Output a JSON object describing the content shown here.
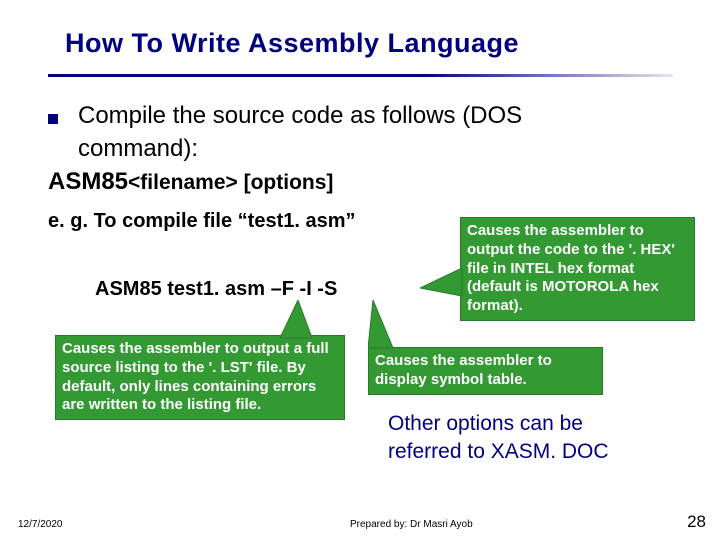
{
  "title": "How To Write Assembly Language",
  "bullet": {
    "line1": "Compile the source code as follows (DOS",
    "line2": "command):"
  },
  "asm85": {
    "cmd": "ASM85",
    "filename": "<filename>",
    "options": " [options]"
  },
  "eg": "e. g. To compile file “test1. asm”",
  "example": "ASM85 test1. asm –F  -I -S",
  "callouts": {
    "c1": "Causes the assembler to output a full source listing to the '. LST' file. By default, only lines containing  errors are written to the listing file.",
    "c2": "Causes the assembler to output the code to  the '. HEX' file in INTEL hex format (default is MOTOROLA hex format).",
    "c3": "Causes the assembler to display symbol table."
  },
  "other": {
    "l1": "Other options can be",
    "l2": "referred to XASM. DOC"
  },
  "footer": {
    "date": "12/7/2020",
    "author": "Prepared by: Dr Masri Ayob",
    "page": "28"
  }
}
